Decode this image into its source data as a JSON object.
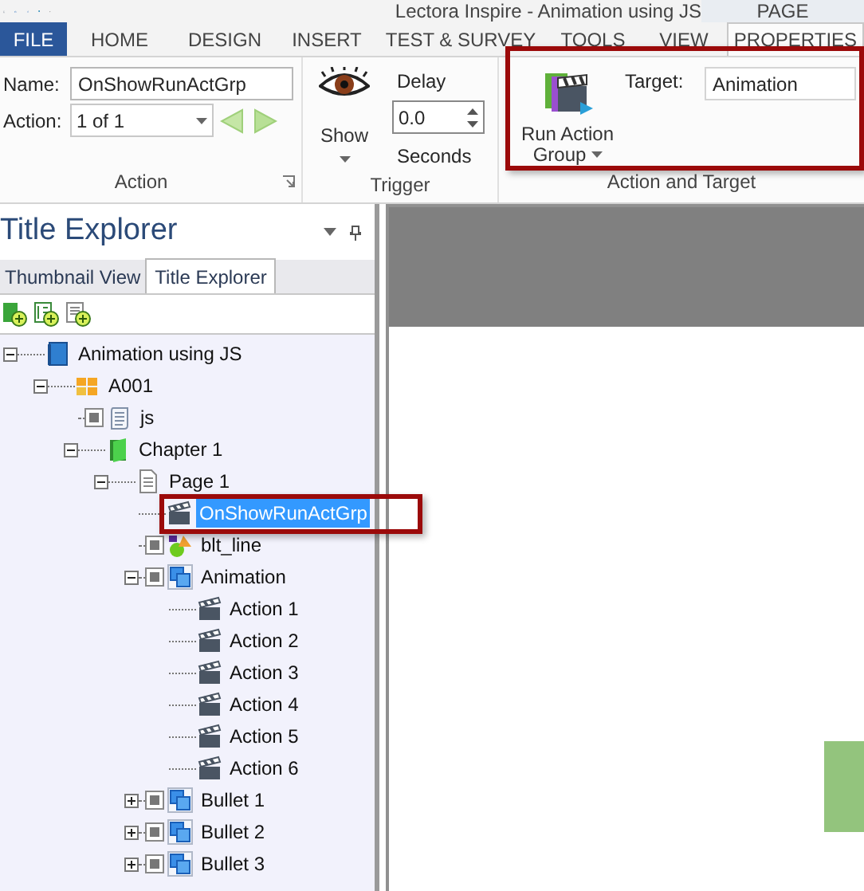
{
  "window": {
    "title": "Lectora Inspire - Animation using JS"
  },
  "contextual_group": {
    "label": "PAGE"
  },
  "ribbon_tabs": [
    {
      "label": "FILE",
      "kind": "file",
      "selected": false
    },
    {
      "label": "HOME",
      "kind": "tab",
      "selected": false
    },
    {
      "label": "DESIGN",
      "kind": "tab",
      "selected": false
    },
    {
      "label": "INSERT",
      "kind": "tab",
      "selected": false
    },
    {
      "label": "TEST & SURVEY",
      "kind": "tab",
      "selected": false
    },
    {
      "label": "TOOLS",
      "kind": "tab",
      "selected": false
    },
    {
      "label": "VIEW",
      "kind": "tab",
      "selected": false
    },
    {
      "label": "PROPERTIES",
      "kind": "contextual",
      "selected": true
    }
  ],
  "action_group": {
    "label": "Action",
    "name_label": "Name:",
    "name_value": "OnShowRunActGrp",
    "action_label": "Action:",
    "action_value": "1 of 1"
  },
  "trigger_group": {
    "label": "Trigger",
    "trigger_button": "Show",
    "delay_label": "Delay",
    "delay_value": "0.0",
    "delay_unit": "Seconds"
  },
  "target_group": {
    "label": "Action and Target",
    "action_button": [
      "Run Action",
      "Group"
    ],
    "target_label": "Target:",
    "target_value": "Animation"
  },
  "explorer": {
    "title": "Title Explorer",
    "tabs": [
      {
        "label": "Thumbnail View",
        "selected": false
      },
      {
        "label": "Title Explorer",
        "selected": true
      }
    ],
    "tree": [
      {
        "label": "Animation using JS",
        "kind": "title",
        "expanded": true,
        "selected": false,
        "children": [
          {
            "label": "A001",
            "kind": "unit",
            "expanded": true,
            "selected": false,
            "children": [
              {
                "label": "js",
                "kind": "script",
                "visibility_box": true,
                "selected": false
              },
              {
                "label": "Chapter 1",
                "kind": "chapter",
                "expanded": true,
                "selected": false,
                "children": [
                  {
                    "label": "Page 1",
                    "kind": "page",
                    "expanded": true,
                    "selected": false,
                    "children": [
                      {
                        "label": "OnShowRunActGrp",
                        "kind": "action",
                        "selected": true
                      },
                      {
                        "label": "blt_line",
                        "kind": "shape",
                        "visibility_box": true,
                        "selected": false
                      },
                      {
                        "label": "Animation",
                        "kind": "group",
                        "expanded": true,
                        "visibility_box": true,
                        "selected": false,
                        "children": [
                          {
                            "label": "Action 1",
                            "kind": "action",
                            "selected": false
                          },
                          {
                            "label": "Action 2",
                            "kind": "action",
                            "selected": false
                          },
                          {
                            "label": "Action 3",
                            "kind": "action",
                            "selected": false
                          },
                          {
                            "label": "Action 4",
                            "kind": "action",
                            "selected": false
                          },
                          {
                            "label": "Action 5",
                            "kind": "action",
                            "selected": false
                          },
                          {
                            "label": "Action 6",
                            "kind": "action",
                            "selected": false
                          }
                        ]
                      },
                      {
                        "label": "Bullet 1",
                        "kind": "group",
                        "expanded": false,
                        "visibility_box": true,
                        "selected": false
                      },
                      {
                        "label": "Bullet 2",
                        "kind": "group",
                        "expanded": false,
                        "visibility_box": true,
                        "selected": false
                      },
                      {
                        "label": "Bullet 3",
                        "kind": "group",
                        "expanded": false,
                        "visibility_box": true,
                        "selected": false
                      }
                    ]
                  }
                ]
              }
            ]
          }
        ]
      }
    ]
  }
}
